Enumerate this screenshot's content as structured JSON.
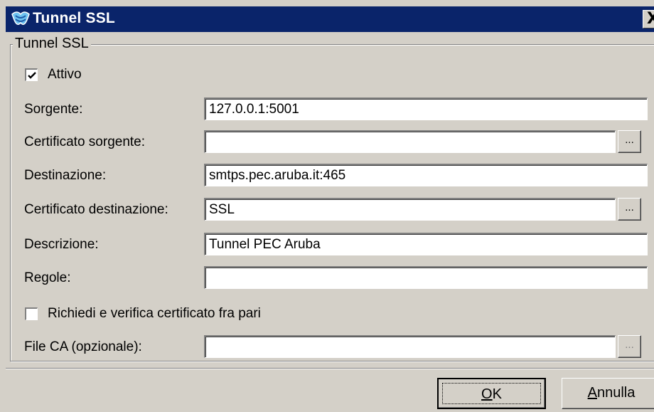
{
  "window": {
    "title": "Tunnel SSL",
    "close_label": "X"
  },
  "group": {
    "title": "Tunnel SSL"
  },
  "form": {
    "active": {
      "label": "Attivo",
      "checked": true
    },
    "source": {
      "label": "Sorgente:",
      "value": "127.0.0.1:5001"
    },
    "source_cert": {
      "label": "Certificato sorgente:",
      "value": "",
      "browse_label": "..."
    },
    "destination": {
      "label": "Destinazione:",
      "value": "smtps.pec.aruba.it:465"
    },
    "dest_cert": {
      "label": "Certificato destinazione:",
      "value": "SSL",
      "browse_label": "..."
    },
    "description": {
      "label": "Descrizione:",
      "value": "Tunnel PEC Aruba"
    },
    "rules": {
      "label": "Regole:",
      "value": ""
    },
    "peer_verify": {
      "label": "Richiedi e verifica certificato fra pari",
      "checked": false
    },
    "ca_file": {
      "label": "File CA (opzionale):",
      "value": "",
      "browse_label": "..."
    }
  },
  "buttons": {
    "ok": {
      "accel": "O",
      "rest": "K"
    },
    "cancel": {
      "accel": "A",
      "rest": "nnulla"
    }
  },
  "colors": {
    "titlebar": "#0a246a",
    "face": "#d4d0c8"
  },
  "icons": {
    "app": "tunnel-app-icon",
    "close": "close-icon",
    "check": "checkmark-icon"
  }
}
